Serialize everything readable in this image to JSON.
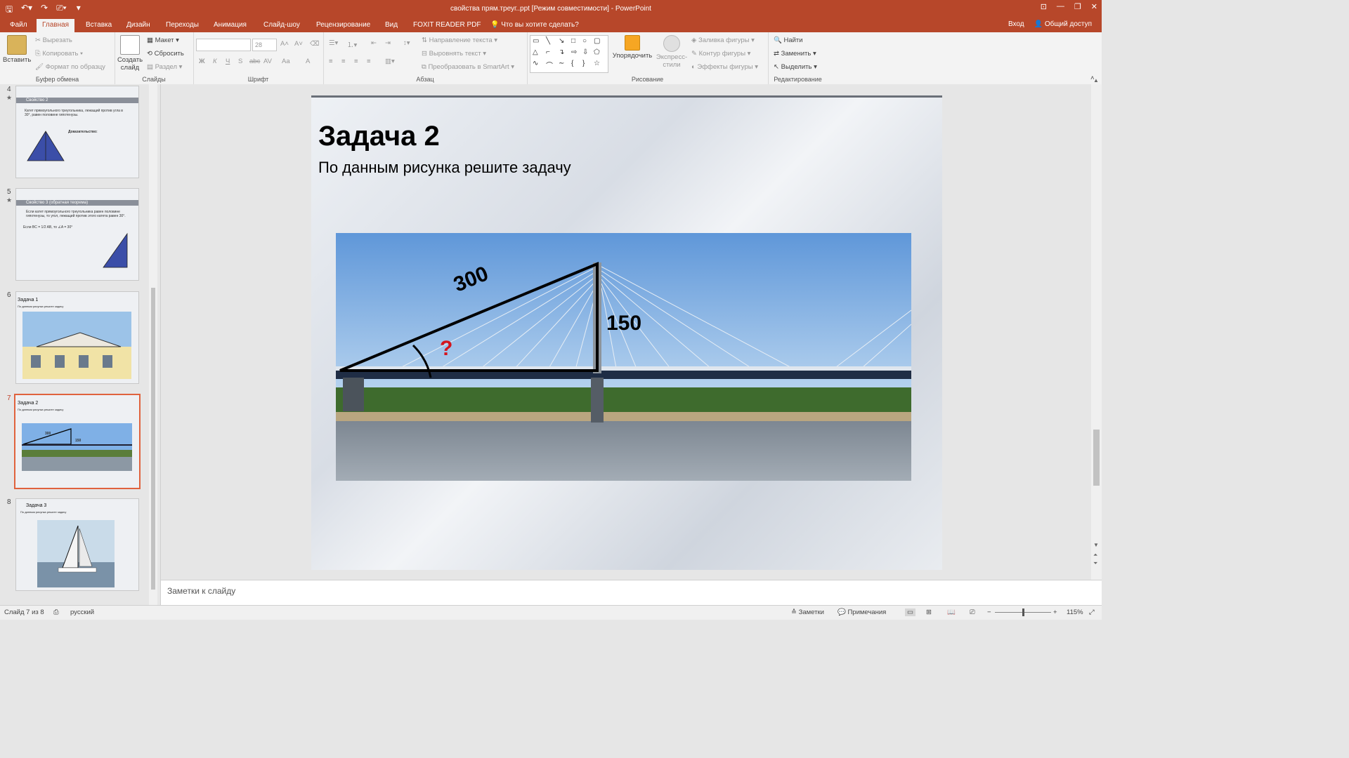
{
  "window": {
    "title": "свойства прям.треуг..ppt [Режим совместимости] - PowerPoint"
  },
  "tabs": [
    {
      "label": "Файл"
    },
    {
      "label": "Главная"
    },
    {
      "label": "Вставка"
    },
    {
      "label": "Дизайн"
    },
    {
      "label": "Переходы"
    },
    {
      "label": "Анимация"
    },
    {
      "label": "Слайд-шоу"
    },
    {
      "label": "Рецензирование"
    },
    {
      "label": "Вид"
    },
    {
      "label": "FOXIT READER PDF"
    }
  ],
  "tell_me": "Что вы хотите сделать?",
  "account": {
    "signin": "Вход",
    "share": "Общий доступ"
  },
  "ribbon": {
    "clipboard": {
      "paste": "Вставить",
      "cut": "Вырезать",
      "copy": "Копировать",
      "format_painter": "Формат по образцу",
      "label": "Буфер обмена"
    },
    "slides": {
      "new_slide_1": "Создать",
      "new_slide_2": "слайд",
      "layout": "Макет",
      "reset": "Сбросить",
      "section": "Раздел",
      "label": "Слайды"
    },
    "font": {
      "name": "",
      "size": "28",
      "bold": "Ж",
      "italic": "К",
      "underline": "Ч",
      "shadow": "S",
      "strike": "abc",
      "spacing": "AV",
      "case": "Aa",
      "color": "A",
      "label": "Шрифт"
    },
    "paragraph": {
      "text_direction": "Направление текста",
      "align_text": "Выровнять текст",
      "smartart": "Преобразовать в SmartArt",
      "label": "Абзац"
    },
    "drawing": {
      "arrange": "Упорядочить",
      "quick_styles_1": "Экспресс-",
      "quick_styles_2": "стили",
      "fill": "Заливка фигуры",
      "outline": "Контур фигуры",
      "effects": "Эффекты фигуры",
      "label": "Рисование"
    },
    "editing": {
      "find": "Найти",
      "replace": "Заменить",
      "select": "Выделить",
      "label": "Редактирование"
    }
  },
  "thumbnails": [
    {
      "num": "4",
      "star": "★",
      "band": "Свойство 2",
      "text": "Катет прямоугольного треугольника, лежащий против угла в 30°, равен половине гипотенузы.",
      "proof": "Доказательство:"
    },
    {
      "num": "5",
      "star": "★",
      "band": "Свойство 3 (обратная теорема)",
      "text": "Если катет прямоугольного треугольника равен половине гипотенузы, то угол, лежащий против этого катета равен 30°.",
      "formula": "Если BC = 1/2 AB, то ∠A = 30°"
    },
    {
      "num": "6",
      "title": "Задача 1",
      "sub": "По данным рисунка решите задачу"
    },
    {
      "num": "7",
      "title": "Задача 2",
      "sub": "По данным рисунка решите задачу",
      "n1": "300",
      "n2": "150"
    },
    {
      "num": "8",
      "title": "Задача 3",
      "sub": "По данным рисунка решите задачу"
    }
  ],
  "slide": {
    "title": "Задача 2",
    "subtitle": "По данным рисунка решите задачу",
    "hyp_label": "300",
    "leg_label": "150",
    "question": "?"
  },
  "notes": {
    "placeholder": "Заметки к слайду"
  },
  "status": {
    "slide_info": "Слайд 7 из 8",
    "language": "русский",
    "notes_btn": "Заметки",
    "comments_btn": "Примечания",
    "zoom": "115%"
  },
  "colors": {
    "accent": "#b7472a",
    "selected_thumb": "#e0623d"
  }
}
